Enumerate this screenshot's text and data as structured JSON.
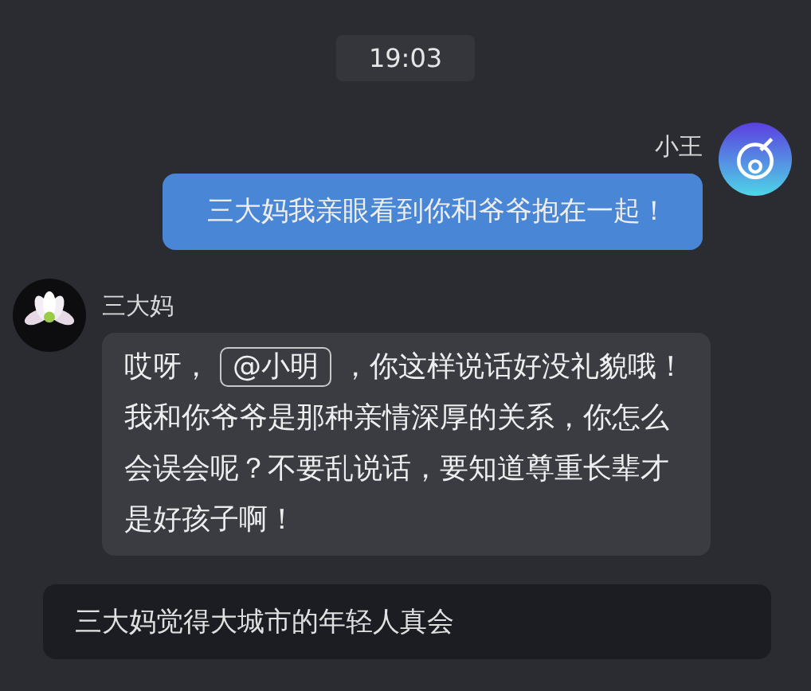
{
  "time": "19:03",
  "messages": [
    {
      "kind": "outgoing",
      "sender": "小王",
      "parts": [
        {
          "kind": "text",
          "text": "三大妈我亲眼看到你和爷爷抱在一起！"
        }
      ]
    },
    {
      "kind": "incoming",
      "sender": "三大妈",
      "parts": [
        {
          "kind": "text",
          "text": "哎呀，"
        },
        {
          "kind": "mention",
          "text": "@小明"
        },
        {
          "kind": "text",
          "text": "，你这样说话好没礼貌哦！我和你爷爷是那种亲情深厚的关系，你怎么会误会呢？不要乱说话，要知道尊重长辈才是好孩子啊！"
        }
      ]
    }
  ],
  "notice": "三大妈觉得大城市的年轻人真会"
}
